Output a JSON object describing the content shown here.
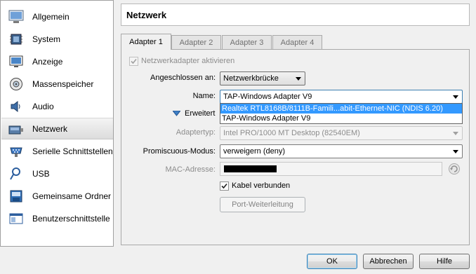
{
  "sidebar": {
    "items": [
      {
        "label": "Allgemein",
        "icon": "general-icon"
      },
      {
        "label": "System",
        "icon": "system-icon"
      },
      {
        "label": "Anzeige",
        "icon": "display-icon"
      },
      {
        "label": "Massenspeicher",
        "icon": "storage-icon"
      },
      {
        "label": "Audio",
        "icon": "audio-icon"
      },
      {
        "label": "Netzwerk",
        "icon": "network-icon",
        "selected": true
      },
      {
        "label": "Serielle Schnittstellen",
        "icon": "serial-port-icon"
      },
      {
        "label": "USB",
        "icon": "usb-icon"
      },
      {
        "label": "Gemeinsame Ordner",
        "icon": "shared-folder-icon"
      },
      {
        "label": "Benutzerschnittstelle",
        "icon": "user-interface-icon"
      }
    ]
  },
  "header": {
    "title": "Netzwerk"
  },
  "tabs": [
    {
      "label": "Adapter 1",
      "active": true
    },
    {
      "label": "Adapter 2"
    },
    {
      "label": "Adapter 3"
    },
    {
      "label": "Adapter 4"
    }
  ],
  "form": {
    "enable_adapter": {
      "label": "Netzwerkadapter aktivieren",
      "checked": true
    },
    "attached_to": {
      "label": "Angeschlossen an:",
      "value": "Netzwerkbrücke"
    },
    "name": {
      "label": "Name:",
      "value": "TAP-Windows Adapter V9"
    },
    "name_options": [
      "Realtek RTL8168B/8111B-Famili...abit-Ethernet-NIC (NDIS 6.20)",
      "TAP-Windows Adapter V9"
    ],
    "advanced": {
      "label": "Erweitert"
    },
    "adapter_type": {
      "label": "Adaptertyp:",
      "value": "Intel PRO/1000 MT Desktop (82540EM)"
    },
    "promiscuous": {
      "label": "Promiscuous-Modus:",
      "value": "verweigern (deny)"
    },
    "mac": {
      "label": "MAC-Adresse:"
    },
    "cable": {
      "label": "Kabel verbunden",
      "checked": true
    },
    "port_forwarding": {
      "label": "Port-Weiterleitung"
    }
  },
  "buttons": {
    "ok": "OK",
    "cancel": "Abbrechen",
    "help": "Hilfe"
  },
  "colors": {
    "highlight": "#3399ff",
    "focus_border": "#3c7fb1"
  }
}
